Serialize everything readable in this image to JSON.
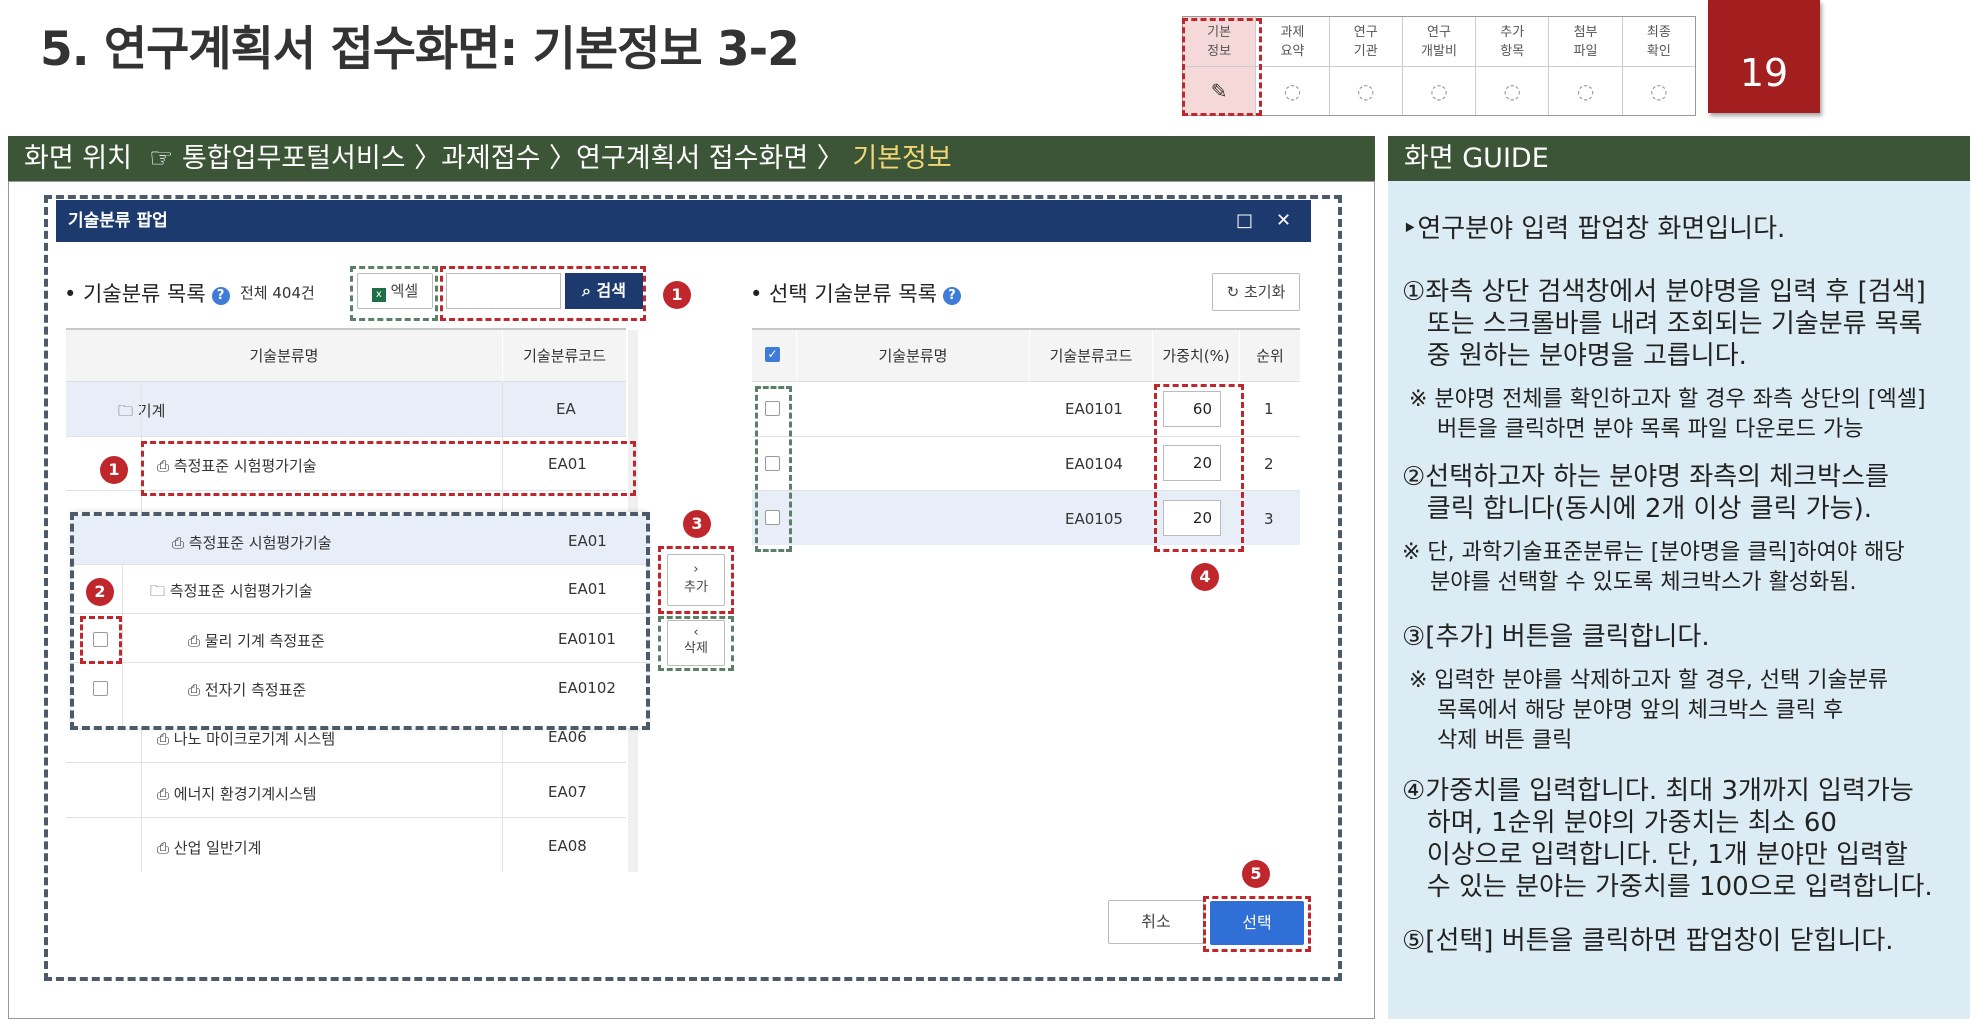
{
  "header": {
    "title": "5. 연구계획서 접수화면: 기본정보 3-2",
    "page_number": "19"
  },
  "steps": [
    {
      "label": "기본\n정보",
      "icon": "edit-icon",
      "active": true
    },
    {
      "label": "과제\n요약",
      "icon": "pending-icon"
    },
    {
      "label": "연구\n기관",
      "icon": "pending-icon"
    },
    {
      "label": "연구\n개발비",
      "icon": "pending-icon"
    },
    {
      "label": "추가\n항목",
      "icon": "pending-icon"
    },
    {
      "label": "첨부\n파일",
      "icon": "pending-icon"
    },
    {
      "label": "최종\n확인",
      "icon": "pending-icon"
    }
  ],
  "location": {
    "prefix": "화면 위치",
    "pointer": "☞",
    "path": "통합업무포털서비스 〉과제접수 〉연구계획서 접수화면 〉",
    "current": "기본정보"
  },
  "popup": {
    "title": "기술분류 팝업",
    "minimize": "□",
    "close": "✕",
    "left": {
      "heading": "• 기술분류 목록",
      "count": "전체 404건",
      "excel": "엑셀",
      "search_placeholder": "",
      "search_button": "검색",
      "col_name": "기술분류명",
      "col_code": "기술분류코드",
      "rows": [
        {
          "name": "기계",
          "code": "EA",
          "icon": "folder"
        },
        {
          "name": "측정표준 시험평가기술",
          "code": "EA01",
          "icon": "doc"
        },
        {
          "name": "나노 마이크로기계 시스템",
          "code": "EA06",
          "icon": "doc"
        },
        {
          "name": "에너지 환경기계시스템",
          "code": "EA07",
          "icon": "doc"
        },
        {
          "name": "산업 일반기계",
          "code": "EA08",
          "icon": "doc"
        }
      ],
      "expanded": [
        {
          "name": "측정표준 시험평가기술",
          "code": "EA01"
        },
        {
          "name": "측정표준 시험평가기술",
          "code": "EA01"
        },
        {
          "name": "물리 기계 측정표준",
          "code": "EA0101"
        },
        {
          "name": "전자기 측정표준",
          "code": "EA0102"
        }
      ]
    },
    "add_label": "추가",
    "delete_label": "삭제",
    "right": {
      "heading": "• 선택 기술분류 목록",
      "reset": "초기화",
      "col_name": "기술분류명",
      "col_code": "기술분류코드",
      "col_weight": "가중치(%)",
      "col_rank": "순위",
      "rows": [
        {
          "code": "EA0101",
          "weight": "60",
          "rank": "1"
        },
        {
          "code": "EA0104",
          "weight": "20",
          "rank": "2"
        },
        {
          "code": "EA0105",
          "weight": "20",
          "rank": "3"
        }
      ]
    },
    "cancel": "취소",
    "select": "선택"
  },
  "guide": {
    "title": "화면 GUIDE",
    "lines": [
      {
        "t": "‣연구분야 입력 팝업창 화면입니다.",
        "s": false
      },
      {
        "t": "①좌측 상단 검색창에서 분야명을 입력 후 [검색]",
        "s": false
      },
      {
        "t": "   또는 스크롤바를 내려 조회되는 기술분류 목록",
        "s": false
      },
      {
        "t": "   중 원하는 분야명을 고릅니다.",
        "s": false
      },
      {
        "t": " ※ 분야명 전체를 확인하고자 할 경우 좌측 상단의 [엑셀]",
        "s": true
      },
      {
        "t": "     버튼을 클릭하면 분야 목록 파일 다운로드 가능",
        "s": true
      },
      {
        "t": "②선택하고자 하는 분야명 좌측의 체크박스를",
        "s": false
      },
      {
        "t": "   클릭 합니다(동시에 2개 이상 클릭 가능).",
        "s": false
      },
      {
        "t": "※ 단, 과학기술표준분류는 [분야명을 클릭]하여야 해당",
        "s": true
      },
      {
        "t": "    분야를 선택할 수 있도록 체크박스가 활성화됨.",
        "s": true
      },
      {
        "t": "③[추가] 버튼을 클릭합니다.",
        "s": false
      },
      {
        "t": " ※ 입력한 분야를 삭제하고자 할 경우, 선택 기술분류",
        "s": true
      },
      {
        "t": "     목록에서 해당 분야명 앞의 체크박스 클릭 후",
        "s": true
      },
      {
        "t": "     삭제 버튼 클릭",
        "s": true
      },
      {
        "t": "④가중치를 입력합니다. 최대 3개까지 입력가능",
        "s": false
      },
      {
        "t": "   하며, 1순위 분야의 가중치는 최소 60",
        "s": false
      },
      {
        "t": "   이상으로 입력합니다. 단, 1개 분야만 입력할",
        "s": false
      },
      {
        "t": "   수 있는 분야는 가중치를 100으로 입력합니다.",
        "s": false
      },
      {
        "t": "⑤[선택] 버튼을 클릭하면 팝업창이 닫힙니다.",
        "s": false
      }
    ]
  },
  "markers": [
    "1",
    "1",
    "2",
    "3",
    "4",
    "5"
  ]
}
